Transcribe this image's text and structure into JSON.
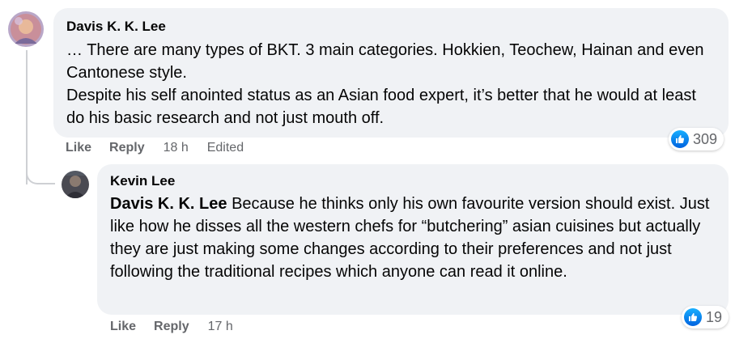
{
  "comments": [
    {
      "author": "Davis K. K. Lee",
      "paragraphs": [
        "… There are many types of BKT. 3 main categories. Hokkien, Teochew, Hainan and even Cantonese style.",
        "Despite his self anointed status as an Asian food expert, it’s better that he would at least do his basic research and not just mouth off."
      ],
      "like_label": "Like",
      "reply_label": "Reply",
      "time": "18 h",
      "edited": "Edited",
      "reaction_count": "309",
      "reaction_icon": "like-icon"
    },
    {
      "author": "Kevin Lee",
      "mention": "Davis K. K. Lee",
      "text": " Because he thinks only his own favourite version should exist. Just like how he disses all the western chefs for “butchering” asian cuisines but actually they are just making some changes according to their preferences and not just following the traditional recipes which anyone can read it online.",
      "like_label": "Like",
      "reply_label": "Reply",
      "time": "17 h",
      "reaction_count": "19",
      "reaction_icon": "like-icon"
    }
  ]
}
